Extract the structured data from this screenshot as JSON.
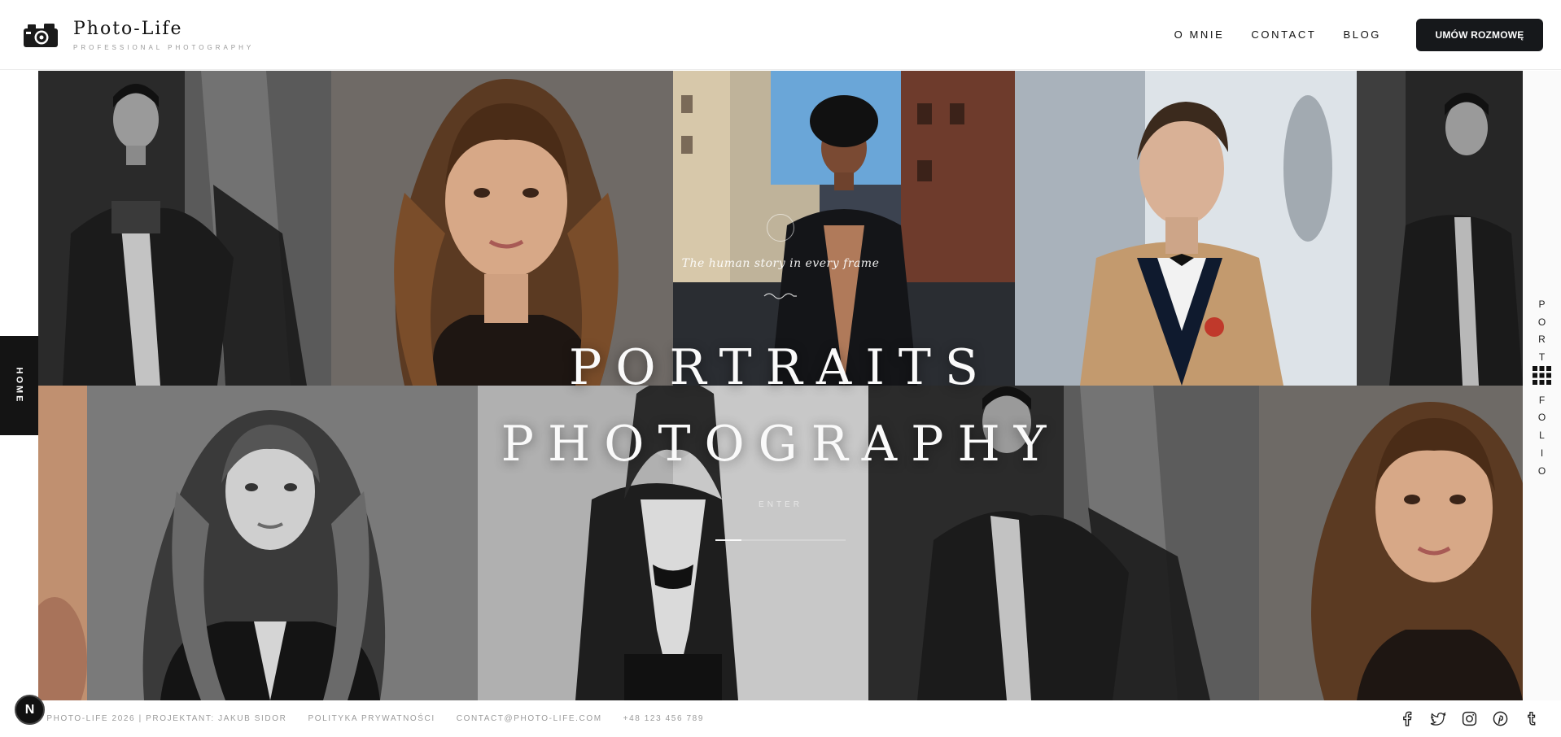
{
  "brand": {
    "title": "Photo-Life",
    "subtitle": "PROFESSIONAL PHOTOGRAPHY",
    "logo_icon": "camera-icon"
  },
  "nav": {
    "items": [
      {
        "label": "O MNIE"
      },
      {
        "label": "CONTACT"
      },
      {
        "label": "BLOG"
      }
    ],
    "cta_label": "UMÓW ROZMOWĘ"
  },
  "hero": {
    "tagline": "The human story in every frame",
    "title_line1": "PORTRAITS",
    "title_line2": "PHOTOGRAPHY",
    "enter_label": "ENTER",
    "progress": 0.2,
    "tiles": [
      {
        "name": "portrait-man-coat-bw"
      },
      {
        "name": "portrait-woman-color"
      },
      {
        "name": "portrait-man-street-color"
      },
      {
        "name": "portrait-man-tuxedo-color"
      },
      {
        "name": "portrait-man-coat-bw-edge"
      },
      {
        "name": "portrait-woman-arm-color-edge"
      },
      {
        "name": "portrait-woman-hair-bw"
      },
      {
        "name": "portrait-woman-blazer-bw"
      },
      {
        "name": "portrait-man-coat-bw"
      },
      {
        "name": "portrait-woman-color-edge"
      }
    ]
  },
  "side": {
    "home_label": "HOME",
    "portfolio_label": "PORTFOLIO",
    "portfolio_icon": "grid-icon"
  },
  "footer": {
    "copyright": "© PHOTO-LIFE 2026 | PROJEKTANT: JAKUB SIDOR",
    "privacy": "POLITYKA PRYWATNOŚCI",
    "email": "CONTACT@PHOTO-LIFE.COM",
    "phone": "+48 123 456 789",
    "socials": [
      "facebook-icon",
      "twitter-icon",
      "instagram-icon",
      "pinterest-icon",
      "tumblr-icon"
    ]
  },
  "badge": {
    "label": "N"
  },
  "colors": {
    "dark": "#16181b",
    "accent_text": "#111111",
    "muted": "#9b9b9b",
    "background": "#ffffff"
  }
}
